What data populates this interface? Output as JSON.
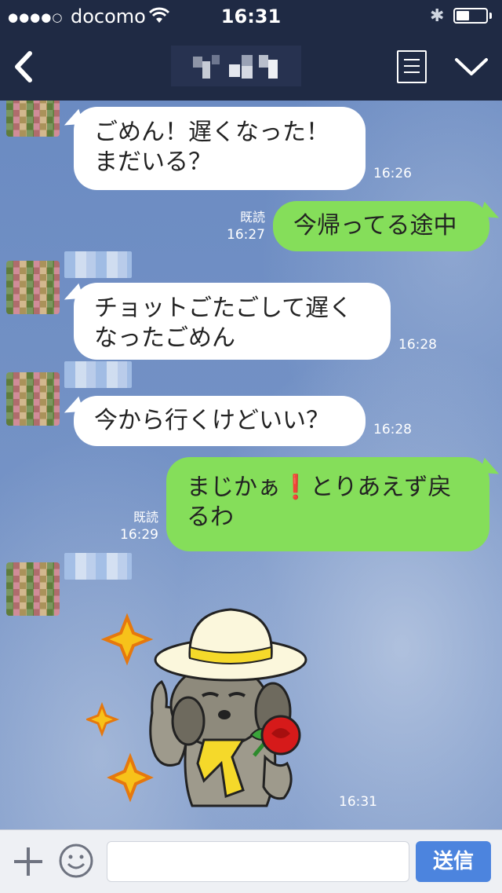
{
  "status_bar": {
    "signal": "●●●●○",
    "carrier": "docomo",
    "wifi_icon": "wifi-icon",
    "time": "16:31",
    "bluetooth_icon": "bluetooth-icon",
    "battery_level": 0.45
  },
  "header": {
    "back_icon": "chevron-left-icon",
    "title": "",
    "menu_icon": "list-icon",
    "collapse_icon": "chevron-down-icon"
  },
  "messages": [
    {
      "side": "left",
      "lines": [
        "ごめん！遅くなった！",
        "まだいる？"
      ],
      "time": "16:26"
    },
    {
      "side": "right",
      "read": "既読",
      "lines": [
        "今帰ってる途中"
      ],
      "time": "16:27"
    },
    {
      "side": "left",
      "lines": [
        "チョットごたごして遅く",
        "なったごめん"
      ],
      "time": "16:28"
    },
    {
      "side": "left",
      "lines": [
        "今から行くけどいい？"
      ],
      "time": "16:28"
    },
    {
      "side": "right",
      "read": "既読",
      "lines": [
        "まじかぁ❗️とりあえず戻",
        "るわ"
      ],
      "time": "16:29"
    },
    {
      "side": "left",
      "sticker": "dog-with-rose-sticker",
      "time": "16:31"
    }
  ],
  "input_bar": {
    "add_icon": "plus-icon",
    "emoji_icon": "smiley-icon",
    "input_value": "",
    "send_label": "送信"
  },
  "colors": {
    "header_bg": "#1f2a44",
    "chat_bg": "#6f8fc3",
    "bubble_in": "#ffffff",
    "bubble_out": "#85de5a",
    "send_button": "#4c84de"
  }
}
